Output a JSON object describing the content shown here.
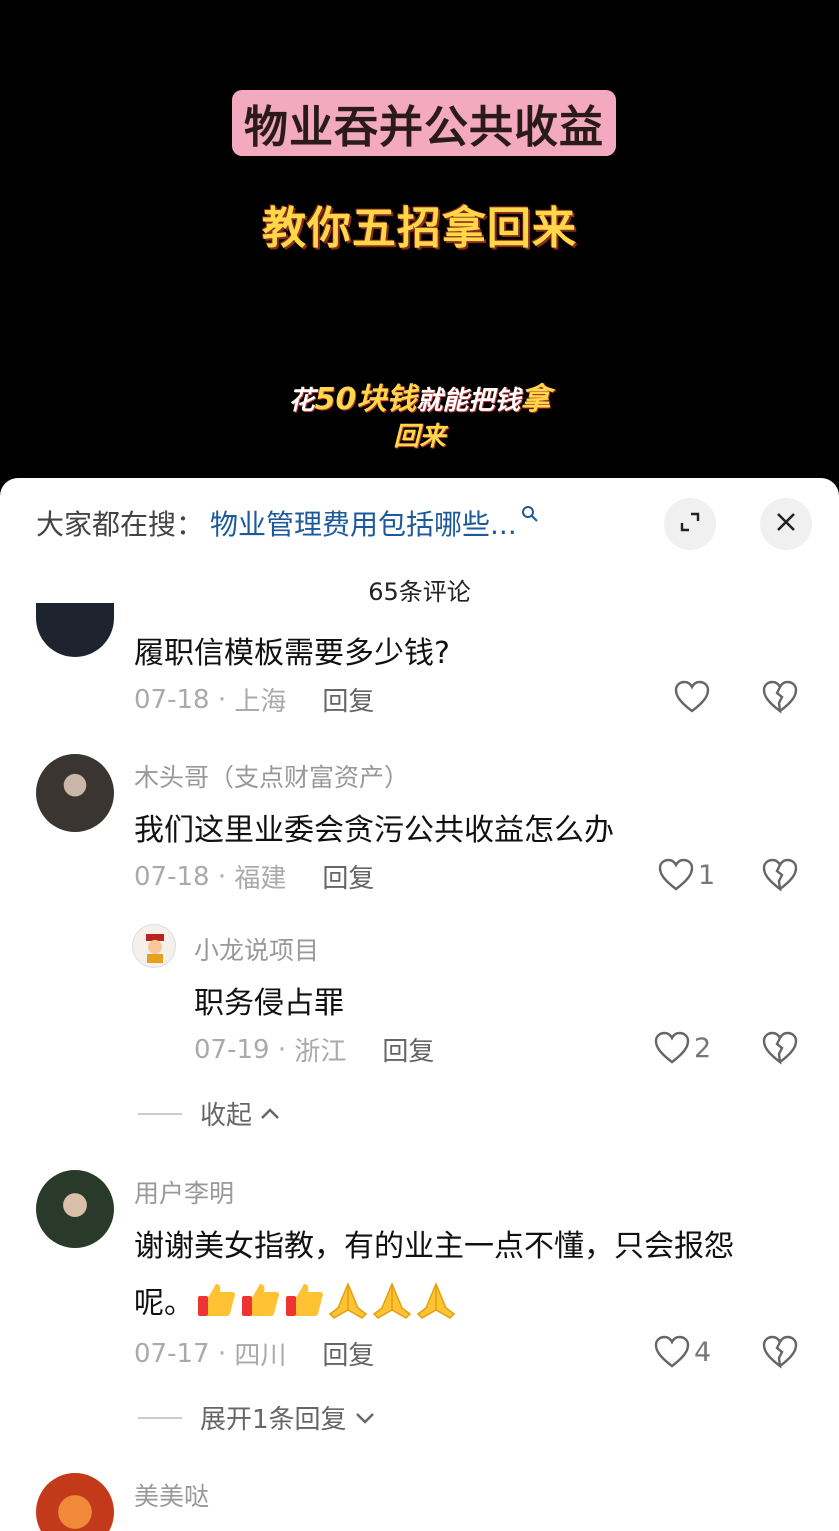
{
  "video": {
    "title_line1": "物业吞并公共收益",
    "title_line2": "教你五招拿回来",
    "subtitle_line1_a": "花",
    "subtitle_line1_b": "50块钱",
    "subtitle_line1_c": "就能把钱",
    "subtitle_line1_d": "拿",
    "subtitle_line2": "回来"
  },
  "sheet": {
    "search_label": "大家都在搜：",
    "search_link": "物业管理费用包括哪些...",
    "comment_count": "65条评论"
  },
  "comments": [
    {
      "text": "履职信模板需要多少钱?",
      "date": "07-18",
      "location": "上海",
      "reply": "回复",
      "likes": ""
    },
    {
      "username": "木头哥（支点财富资产）",
      "text": "我们这里业委会贪污公共收益怎么办",
      "date": "07-18",
      "location": "福建",
      "reply": "回复",
      "likes": "1"
    },
    {
      "username": "小龙说项目",
      "text": "职务侵占罪",
      "date": "07-19",
      "location": "浙江",
      "reply": "回复",
      "likes": "2"
    },
    {
      "username": "用户李明",
      "text_line1": "谢谢美女指教，有的业主一点不懂，只会报怨",
      "text_line2": "呢。",
      "date": "07-17",
      "location": "四川",
      "reply": "回复",
      "likes": "4"
    },
    {
      "username": "美美哒"
    }
  ],
  "fold_collapse": "收起",
  "fold_expand": "展开1条回复",
  "colors": {
    "title_bg": "#f3a9bf",
    "title_yellow": "#ffd84a",
    "link_blue": "#1d5a9b"
  }
}
